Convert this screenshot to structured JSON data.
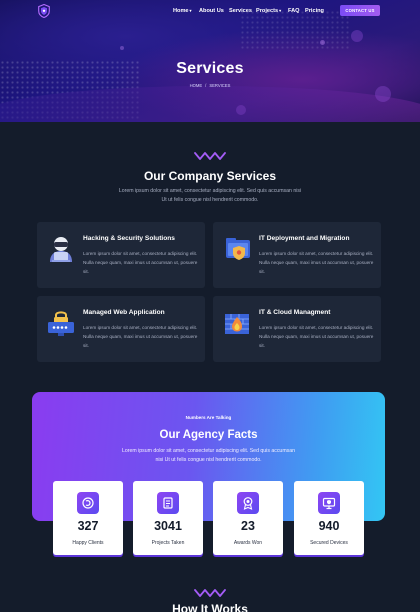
{
  "nav": {
    "items": [
      {
        "label": "Home",
        "dropdown": true
      },
      {
        "label": "About Us",
        "dropdown": false
      },
      {
        "label": "Services",
        "dropdown": false
      },
      {
        "label": "Projects",
        "dropdown": true
      },
      {
        "label": "FAQ",
        "dropdown": false
      },
      {
        "label": "Pricing",
        "dropdown": false
      }
    ],
    "caret": "▾",
    "contact_label": "CONTACT US"
  },
  "hero": {
    "title": "Services",
    "breadcrumb": [
      "HOME",
      "/",
      "SERVICES"
    ]
  },
  "company": {
    "title": "Our Company Services",
    "desc": "Lorem ipsum dolor sit amet, consectetur adipiscing elit. Sed quis accumsan nisi Ut ut felis congue nisl hendrerit commodo."
  },
  "services": [
    {
      "title": "Hacking & Security Solutions",
      "text": "Lorem ipsum dolor sit amet, consectetur adipiscing elit. Nulla neque quam, maxi imus ut accumsan ut, posuere sit.",
      "icon": "hacker-icon"
    },
    {
      "title": "IT Deployment and Migration",
      "text": "Lorem ipsum dolor sit amet, consectetur adipiscing elit. Nulla neque quam, maxi imus ut accumsan ut, posuere sit.",
      "icon": "folder-security-icon"
    },
    {
      "title": "Managed Web Application",
      "text": "Lorem ipsum dolor sit amet, consectetur adipiscing elit. Nulla neque quam, maxi imus ut accumsan ut, posuere sit.",
      "icon": "password-lock-icon"
    },
    {
      "title": "IT & Cloud Managment",
      "text": "Lorem ipsum dolor sit amet, consectetur adipiscing elit. Nulla neque quam, maxi imus ut accumsan ut, posuere sit.",
      "icon": "firewall-icon"
    }
  ],
  "facts": {
    "kicker": "Numbers Are Talking",
    "title": "Our Agency Facts",
    "desc": "Lorem ipsum dolor sit amet, consectetur adipiscing elit. Sed quis accumsan nisi Ut ut felis congue nisl hendrerit commodo.",
    "stats": [
      {
        "value": "327",
        "label": "Happy Clients",
        "icon": "clients-icon"
      },
      {
        "value": "3041",
        "label": "Projects Taken",
        "icon": "projects-icon"
      },
      {
        "value": "23",
        "label": "Awards Won",
        "icon": "award-icon"
      },
      {
        "value": "940",
        "label": "Secured Devices",
        "icon": "devices-icon"
      }
    ]
  },
  "next_section": {
    "title": "How It Works"
  },
  "colors": {
    "accent": "#8a3cf0",
    "accent_2": "#33c6f3",
    "background": "#141c2b",
    "card": "#1e2738"
  }
}
